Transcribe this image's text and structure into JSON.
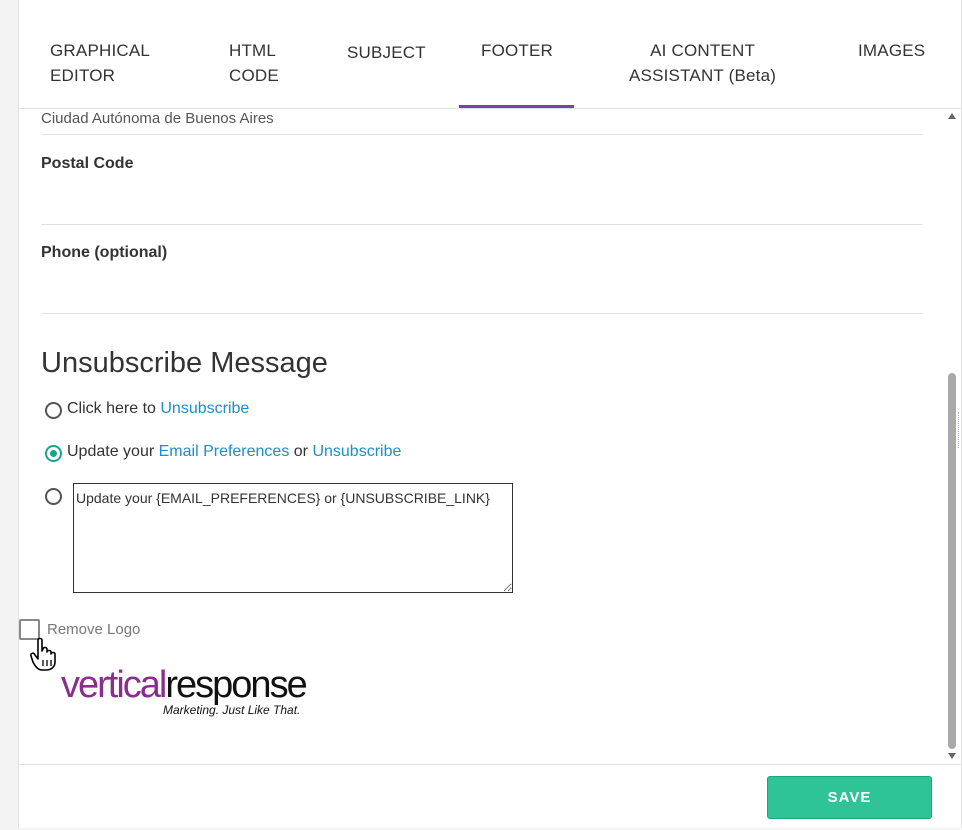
{
  "tabs": {
    "graphical_editor": {
      "line1": "GRAPHICAL",
      "line2": "EDITOR"
    },
    "html_code": {
      "line1": "HTML",
      "line2": "CODE"
    },
    "subject": "SUBJECT",
    "footer": "FOOTER",
    "ai_assistant": {
      "line1": "AI CONTENT",
      "line2": "ASSISTANT (Beta)"
    },
    "images": "IMAGES",
    "active": "FOOTER"
  },
  "form": {
    "state_value": "Ciudad Autónoma de Buenos Aires",
    "postal_code_label": "Postal Code",
    "postal_code_value": "",
    "phone_label": "Phone (optional)",
    "phone_value": ""
  },
  "unsubscribe": {
    "title": "Unsubscribe Message",
    "options": [
      {
        "prefix": "Click here to ",
        "link1": "Unsubscribe",
        "selected": false
      },
      {
        "prefix": "Update your ",
        "link1": "Email Preferences",
        "middle": " or ",
        "link2": "Unsubscribe",
        "selected": true
      }
    ],
    "custom_text": "Update your {EMAIL_PREFERENCES} or {UNSUBSCRIBE_LINK}",
    "custom_selected": false
  },
  "remove_logo": {
    "label": "Remove Logo",
    "checked": false
  },
  "logo": {
    "part1": "vertical",
    "part2": "response",
    "tagline": "Marketing. Just Like That."
  },
  "footer_bar": {
    "save_label": "SAVE"
  },
  "colors": {
    "accent_purple": "#7b3fa6",
    "link_blue": "#1a8fc9",
    "radio_green": "#1aa38d",
    "save_green": "#2fc495"
  },
  "icons": {
    "cursor": "hand-pointer-icon",
    "scroll_up": "triangle-up-icon",
    "scroll_down": "triangle-down-icon"
  }
}
